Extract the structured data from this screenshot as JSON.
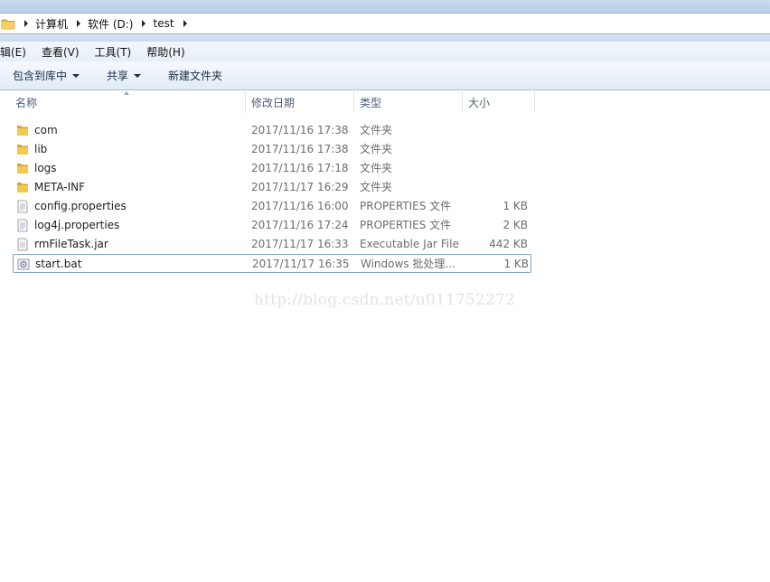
{
  "breadcrumb": [
    "计算机",
    "软件 (D:)",
    "test"
  ],
  "menu": [
    "编辑(E)",
    "查看(V)",
    "工具(T)",
    "帮助(H)"
  ],
  "commands": [
    {
      "label": "包含到库中",
      "dropdown": true
    },
    {
      "label": "共享",
      "dropdown": true
    },
    {
      "label": "新建文件夹",
      "dropdown": false
    }
  ],
  "columns": {
    "name": "名称",
    "date": "修改日期",
    "type": "类型",
    "size": "大小"
  },
  "files": [
    {
      "icon": "folder-icon",
      "name": "com",
      "date": "2017/11/16 17:38",
      "type": "文件夹",
      "size": ""
    },
    {
      "icon": "folder-icon",
      "name": "lib",
      "date": "2017/11/16 17:38",
      "type": "文件夹",
      "size": ""
    },
    {
      "icon": "folder-icon",
      "name": "logs",
      "date": "2017/11/16 17:18",
      "type": "文件夹",
      "size": ""
    },
    {
      "icon": "folder-icon",
      "name": "META-INF",
      "date": "2017/11/17 16:29",
      "type": "文件夹",
      "size": ""
    },
    {
      "icon": "properties-file-icon",
      "name": "config.properties",
      "date": "2017/11/16 16:00",
      "type": "PROPERTIES 文件",
      "size": "1 KB"
    },
    {
      "icon": "properties-file-icon",
      "name": "log4j.properties",
      "date": "2017/11/16 17:24",
      "type": "PROPERTIES 文件",
      "size": "2 KB"
    },
    {
      "icon": "jar-file-icon",
      "name": "rmFileTask.jar",
      "date": "2017/11/17 16:33",
      "type": "Executable Jar File",
      "size": "442 KB"
    },
    {
      "icon": "bat-file-icon",
      "name": "start.bat",
      "date": "2017/11/17 16:35",
      "type": "Windows 批处理...",
      "size": "1 KB"
    }
  ],
  "selected_file": "start.bat",
  "watermark": "http://blog.csdn.net/u011752272",
  "colors": {
    "folder": "#e8b53c",
    "selection_border": "#7da2ce",
    "header_text": "#4c607a"
  }
}
